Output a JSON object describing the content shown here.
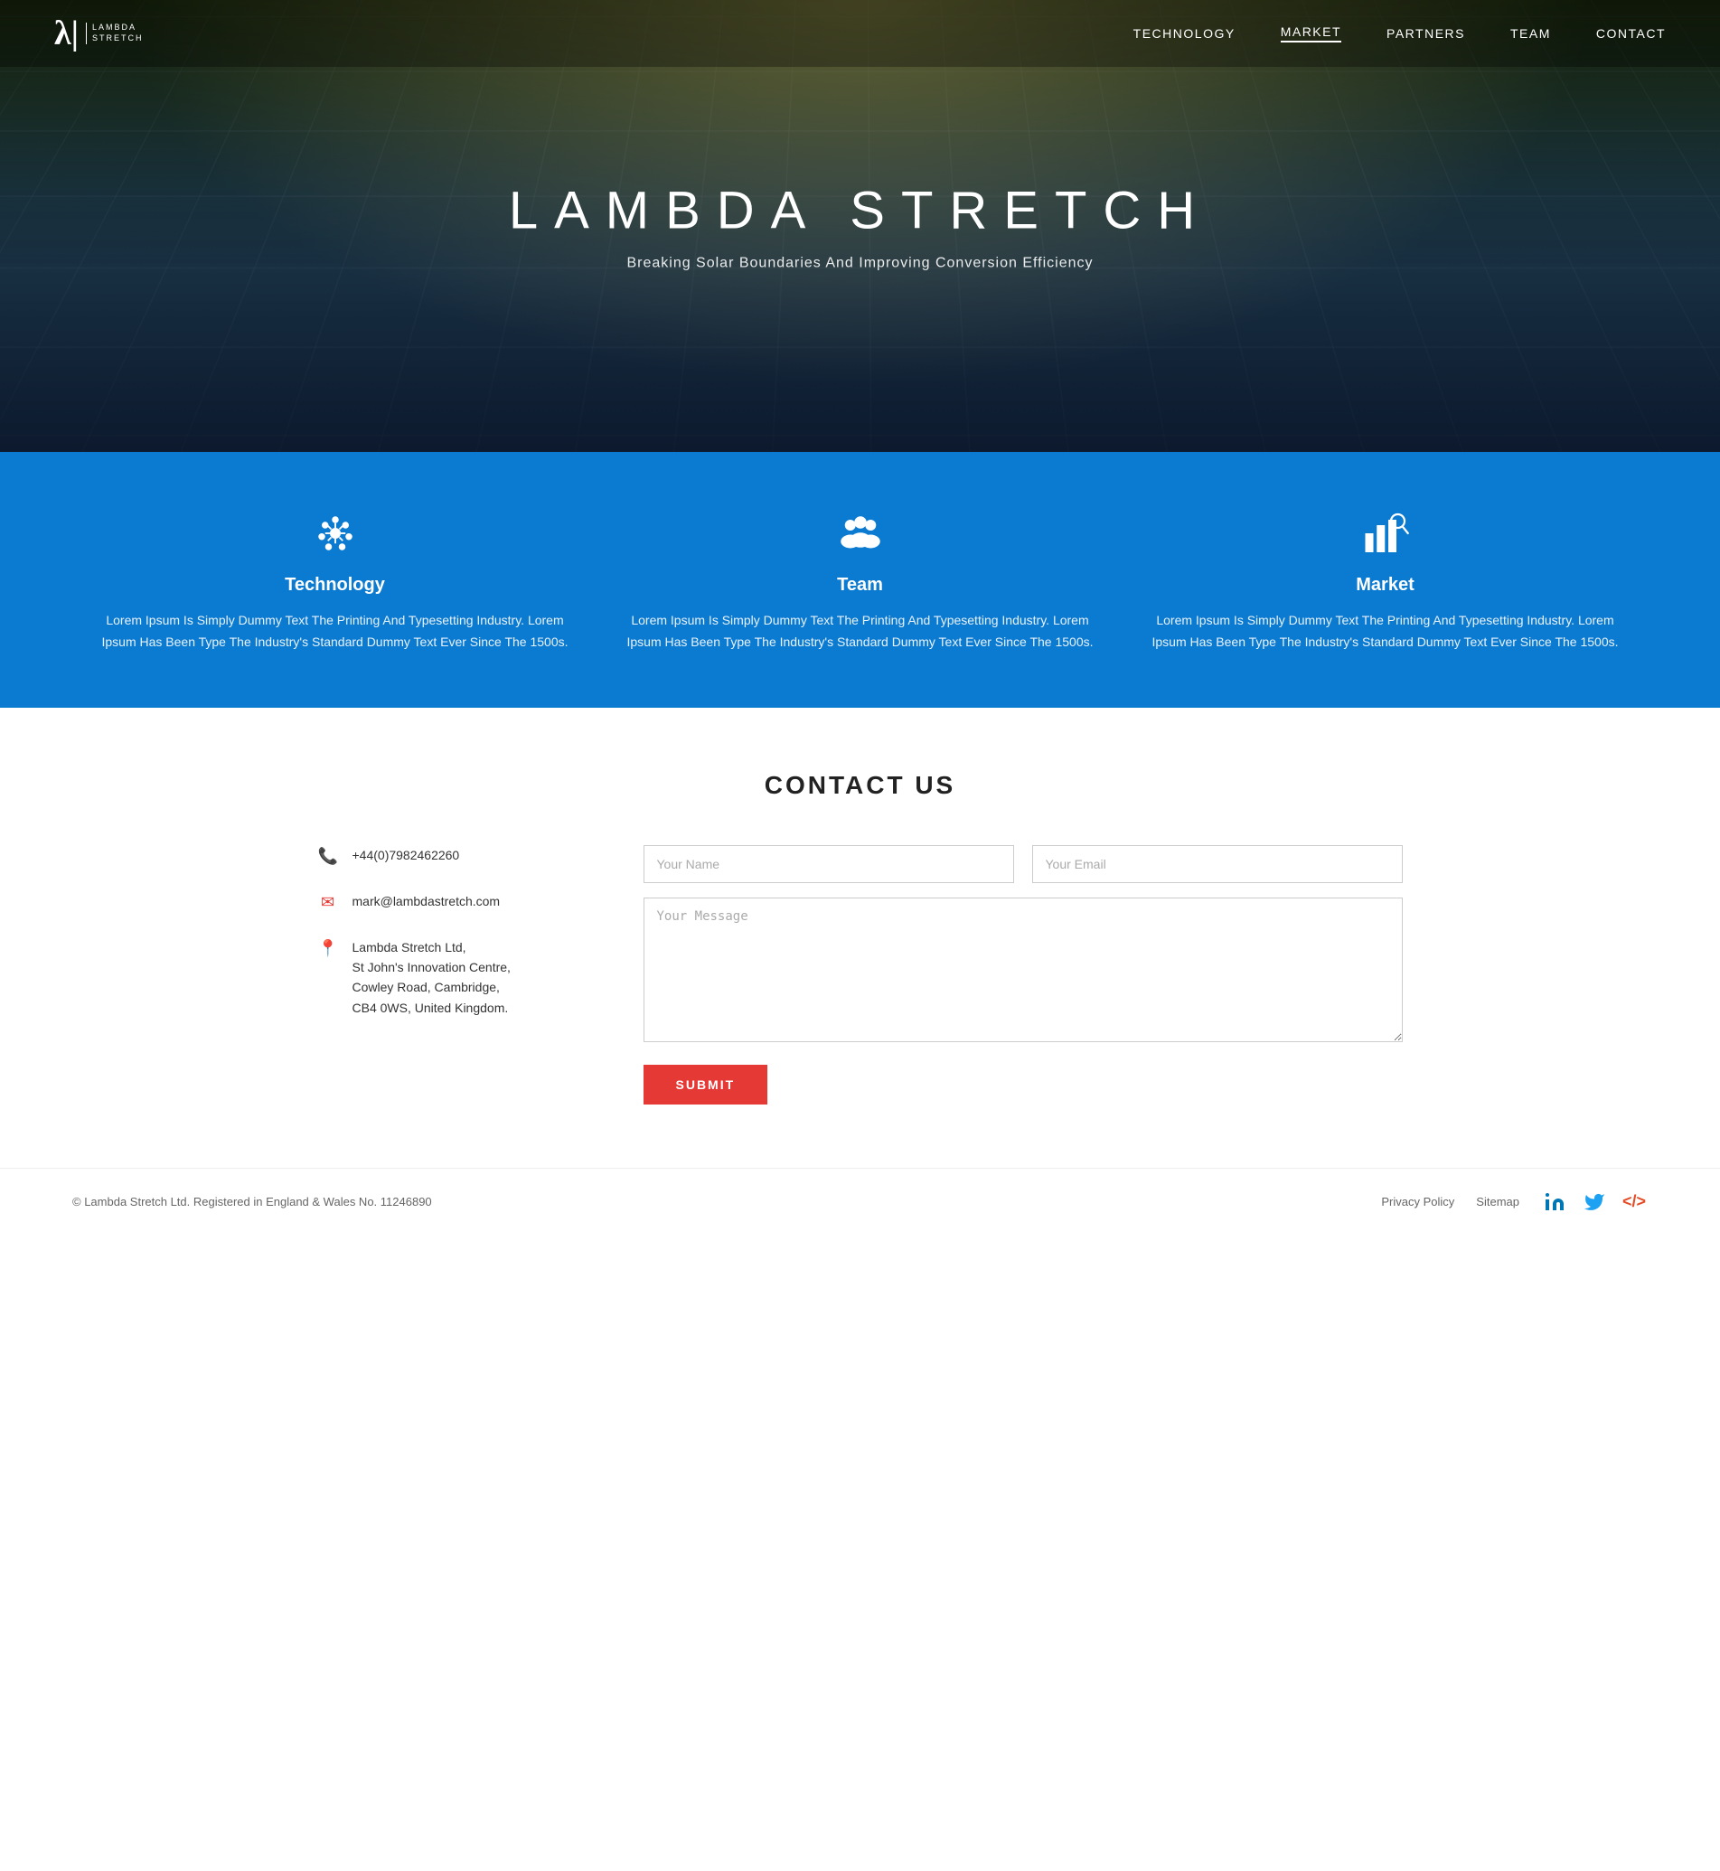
{
  "header": {
    "logo_symbol": "λ|",
    "logo_text_line1": "LAMBDA",
    "logo_text_line2": "STRETCH",
    "nav": [
      {
        "label": "TECHNOLOGY",
        "active": false
      },
      {
        "label": "MARKET",
        "active": true
      },
      {
        "label": "PARTNERS",
        "active": false
      },
      {
        "label": "TEAM",
        "active": false
      },
      {
        "label": "CONTACT",
        "active": false
      }
    ]
  },
  "hero": {
    "title": "LAMBDA STRETCH",
    "subtitle": "Breaking Solar Boundaries And Improving Conversion Efficiency"
  },
  "features": [
    {
      "id": "technology",
      "title": "Technology",
      "text": "Lorem Ipsum Is Simply Dummy Text The Printing And Typesetting Industry. Lorem Ipsum Has Been Type The Industry's Standard Dummy Text Ever Since The 1500s.",
      "icon": "gear"
    },
    {
      "id": "team",
      "title": "Team",
      "text": "Lorem Ipsum Is Simply Dummy Text The Printing And Typesetting Industry. Lorem Ipsum Has Been Type The Industry's Standard Dummy Text Ever Since The 1500s.",
      "icon": "people"
    },
    {
      "id": "market",
      "title": "Market",
      "text": "Lorem Ipsum Is Simply Dummy Text The Printing And Typesetting Industry. Lorem Ipsum Has Been Type The Industry's Standard Dummy Text Ever Since The 1500s.",
      "icon": "chart"
    }
  ],
  "contact": {
    "title": "CONTACT US",
    "phone": "+44(0)7982462260",
    "email": "mark@lambdastretch.com",
    "address_line1": "Lambda Stretch Ltd,",
    "address_line2": "St John's Innovation Centre,",
    "address_line3": "Cowley Road, Cambridge,",
    "address_line4": "CB4 0WS, United Kingdom.",
    "form": {
      "name_placeholder": "Your Name",
      "email_placeholder": "Your Email",
      "message_placeholder": "Your Message",
      "submit_label": "SUBMIT"
    }
  },
  "footer": {
    "copyright": "© Lambda Stretch Ltd. Registered in England & Wales No. 11246890",
    "privacy_label": "Privacy Policy",
    "sitemap_label": "Sitemap"
  }
}
